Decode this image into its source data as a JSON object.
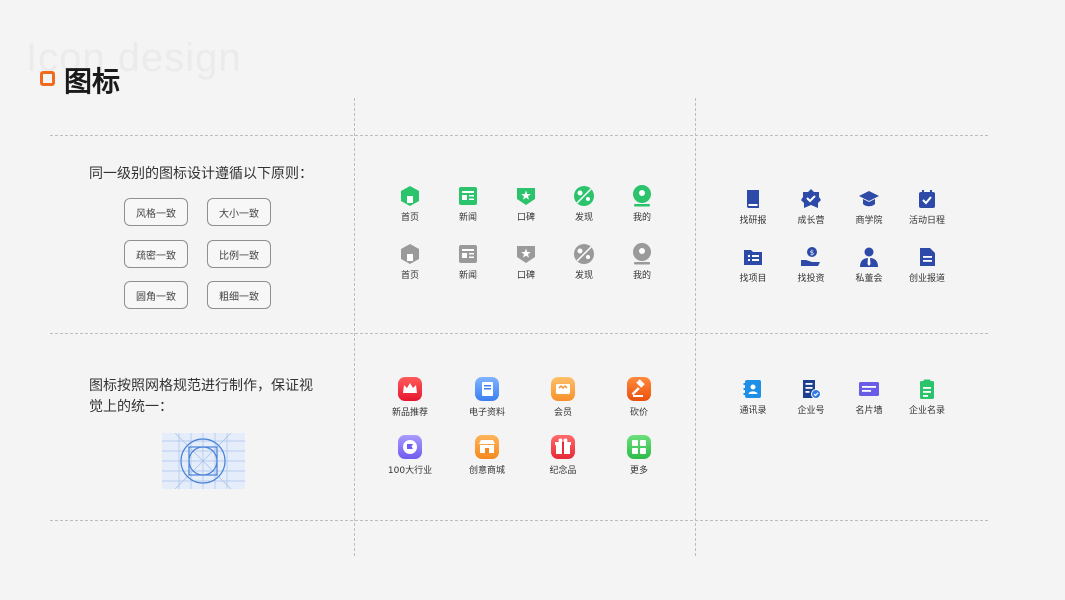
{
  "watermark": "Icon design",
  "title": "图标",
  "sections": {
    "principles": {
      "text": "同一级别的图标设计遵循以下原则：",
      "pills": [
        "风格一致",
        "大小一致",
        "疏密一致",
        "比例一致",
        "圆角一致",
        "粗细一致"
      ]
    },
    "grid": {
      "line1": "图标按照网格规范进行制作，保证视",
      "line2": "觉上的统一："
    }
  },
  "green_row": [
    "首页",
    "新闻",
    "口碑",
    "发现",
    "我的"
  ],
  "gray_row": [
    "首页",
    "新闻",
    "口碑",
    "发现",
    "我的"
  ],
  "blue_row1": [
    "找研报",
    "成长营",
    "商学院",
    "活动日程"
  ],
  "blue_row2": [
    "找项目",
    "找投资",
    "私董会",
    "创业报道"
  ],
  "color_row1": [
    "新品推荐",
    "电子资料",
    "会员",
    "砍价"
  ],
  "color_row2": [
    "100大行业",
    "创意商城",
    "纪念品",
    "更多"
  ],
  "blue_row3": [
    "通讯录",
    "企业号",
    "名片墙",
    "企业名录"
  ],
  "colors": {
    "accent": "#f26a1b",
    "green": "#2bc46c",
    "gray": "#9a9a9a",
    "navy": "#2e4aa8"
  }
}
